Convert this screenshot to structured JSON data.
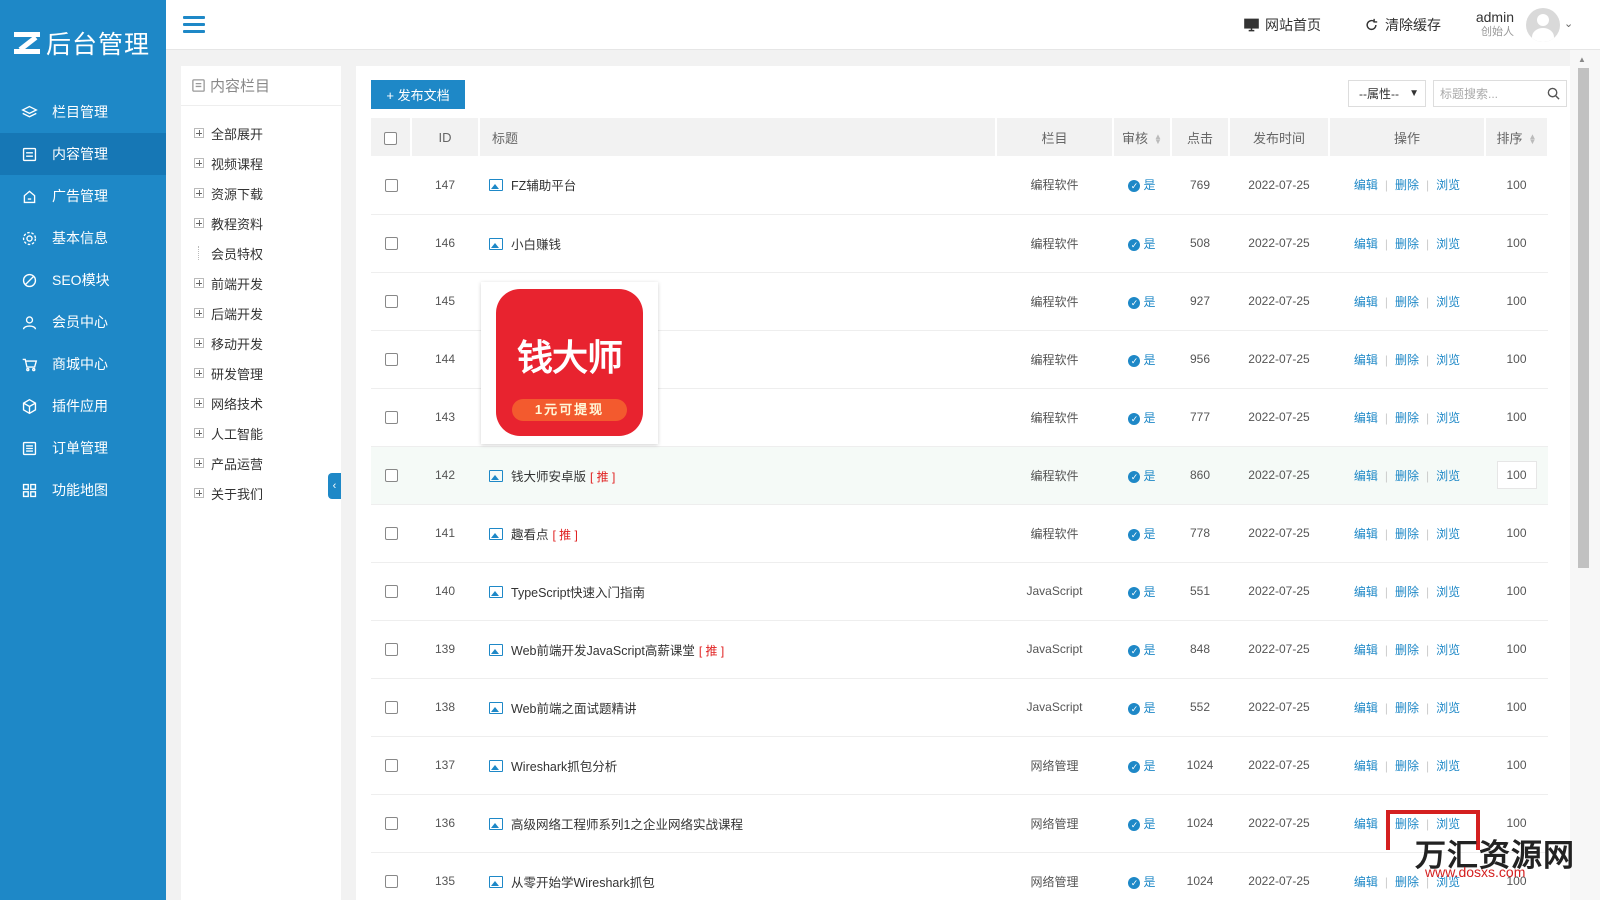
{
  "logo": {
    "text": "后台管理"
  },
  "sidebar": {
    "items": [
      {
        "label": "栏目管理",
        "icon": "layers-icon",
        "active": false
      },
      {
        "label": "内容管理",
        "icon": "document-icon",
        "active": true
      },
      {
        "label": "广告管理",
        "icon": "ad-icon",
        "active": false
      },
      {
        "label": "基本信息",
        "icon": "gear-icon",
        "active": false
      },
      {
        "label": "SEO模块",
        "icon": "seo-icon",
        "active": false
      },
      {
        "label": "会员中心",
        "icon": "user-icon",
        "active": false
      },
      {
        "label": "商城中心",
        "icon": "cart-icon",
        "active": false
      },
      {
        "label": "插件应用",
        "icon": "plugin-icon",
        "active": false
      },
      {
        "label": "订单管理",
        "icon": "list-icon",
        "active": false
      },
      {
        "label": "功能地图",
        "icon": "grid-icon",
        "active": false
      }
    ]
  },
  "topbar": {
    "site_home": "网站首页",
    "clear_cache": "清除缓存",
    "user_name": "admin",
    "user_role": "创始人"
  },
  "tree": {
    "title": "内容栏目",
    "items": [
      {
        "label": "全部展开",
        "expandable": true
      },
      {
        "label": "视频课程",
        "expandable": true
      },
      {
        "label": "资源下载",
        "expandable": true
      },
      {
        "label": "教程资料",
        "expandable": true
      },
      {
        "label": "会员特权",
        "expandable": false
      },
      {
        "label": "前端开发",
        "expandable": true
      },
      {
        "label": "后端开发",
        "expandable": true
      },
      {
        "label": "移动开发",
        "expandable": true
      },
      {
        "label": "研发管理",
        "expandable": true
      },
      {
        "label": "网络技术",
        "expandable": true
      },
      {
        "label": "人工智能",
        "expandable": true
      },
      {
        "label": "产品运营",
        "expandable": true
      },
      {
        "label": "关于我们",
        "expandable": true
      }
    ]
  },
  "toolbar": {
    "publish_label": "+ 发布文档",
    "attr_select": "--属性--",
    "search_placeholder": "标题搜索..."
  },
  "table": {
    "headers": {
      "id": "ID",
      "title": "标题",
      "column": "栏目",
      "audit": "审核",
      "clicks": "点击",
      "date": "发布时间",
      "ops": "操作",
      "sort": "排序"
    },
    "op_labels": {
      "edit": "编辑",
      "delete": "删除",
      "view": "浏览"
    },
    "audit_label": "是",
    "tag_label": "[ 推 ]",
    "rows": [
      {
        "id": "147",
        "title": "FZ辅助平台",
        "tag": false,
        "column": "编程软件",
        "clicks": "769",
        "date": "2022-07-25",
        "sort": "100"
      },
      {
        "id": "146",
        "title": "小白赚钱",
        "tag": false,
        "column": "编程软件",
        "clicks": "508",
        "date": "2022-07-25",
        "sort": "100"
      },
      {
        "id": "145",
        "title": "",
        "tag": false,
        "column": "编程软件",
        "clicks": "927",
        "date": "2022-07-25",
        "sort": "100"
      },
      {
        "id": "144",
        "title": "",
        "tag": false,
        "column": "编程软件",
        "clicks": "956",
        "date": "2022-07-25",
        "sort": "100"
      },
      {
        "id": "143",
        "title": "",
        "tag": false,
        "column": "编程软件",
        "clicks": "777",
        "date": "2022-07-25",
        "sort": "100"
      },
      {
        "id": "142",
        "title": "钱大师安卓版",
        "tag": true,
        "column": "编程软件",
        "clicks": "860",
        "date": "2022-07-25",
        "sort": "100",
        "highlight": true
      },
      {
        "id": "141",
        "title": "趣看点",
        "tag": true,
        "column": "编程软件",
        "clicks": "778",
        "date": "2022-07-25",
        "sort": "100"
      },
      {
        "id": "140",
        "title": "TypeScript快速入门指南",
        "tag": false,
        "column": "JavaScript",
        "clicks": "551",
        "date": "2022-07-25",
        "sort": "100"
      },
      {
        "id": "139",
        "title": "Web前端开发JavaScript高薪课堂",
        "tag": true,
        "column": "JavaScript",
        "clicks": "848",
        "date": "2022-07-25",
        "sort": "100"
      },
      {
        "id": "138",
        "title": "Web前端之面试题精讲",
        "tag": false,
        "column": "JavaScript",
        "clicks": "552",
        "date": "2022-07-25",
        "sort": "100"
      },
      {
        "id": "137",
        "title": "Wireshark抓包分析",
        "tag": false,
        "column": "网络管理",
        "clicks": "1024",
        "date": "2022-07-25",
        "sort": "100"
      },
      {
        "id": "136",
        "title": "高级网络工程师系列1之企业网络实战课程",
        "tag": false,
        "column": "网络管理",
        "clicks": "1024",
        "date": "2022-07-25",
        "sort": "100"
      },
      {
        "id": "135",
        "title": "从零开始学Wireshark抓包",
        "tag": false,
        "column": "网络管理",
        "clicks": "1024",
        "date": "2022-07-25",
        "sort": "100"
      }
    ]
  },
  "preview": {
    "app_name": "钱大师",
    "app_slogan": "1元可提现"
  },
  "watermark": {
    "text": "万汇资源网",
    "url": "www.dosxs.com"
  }
}
